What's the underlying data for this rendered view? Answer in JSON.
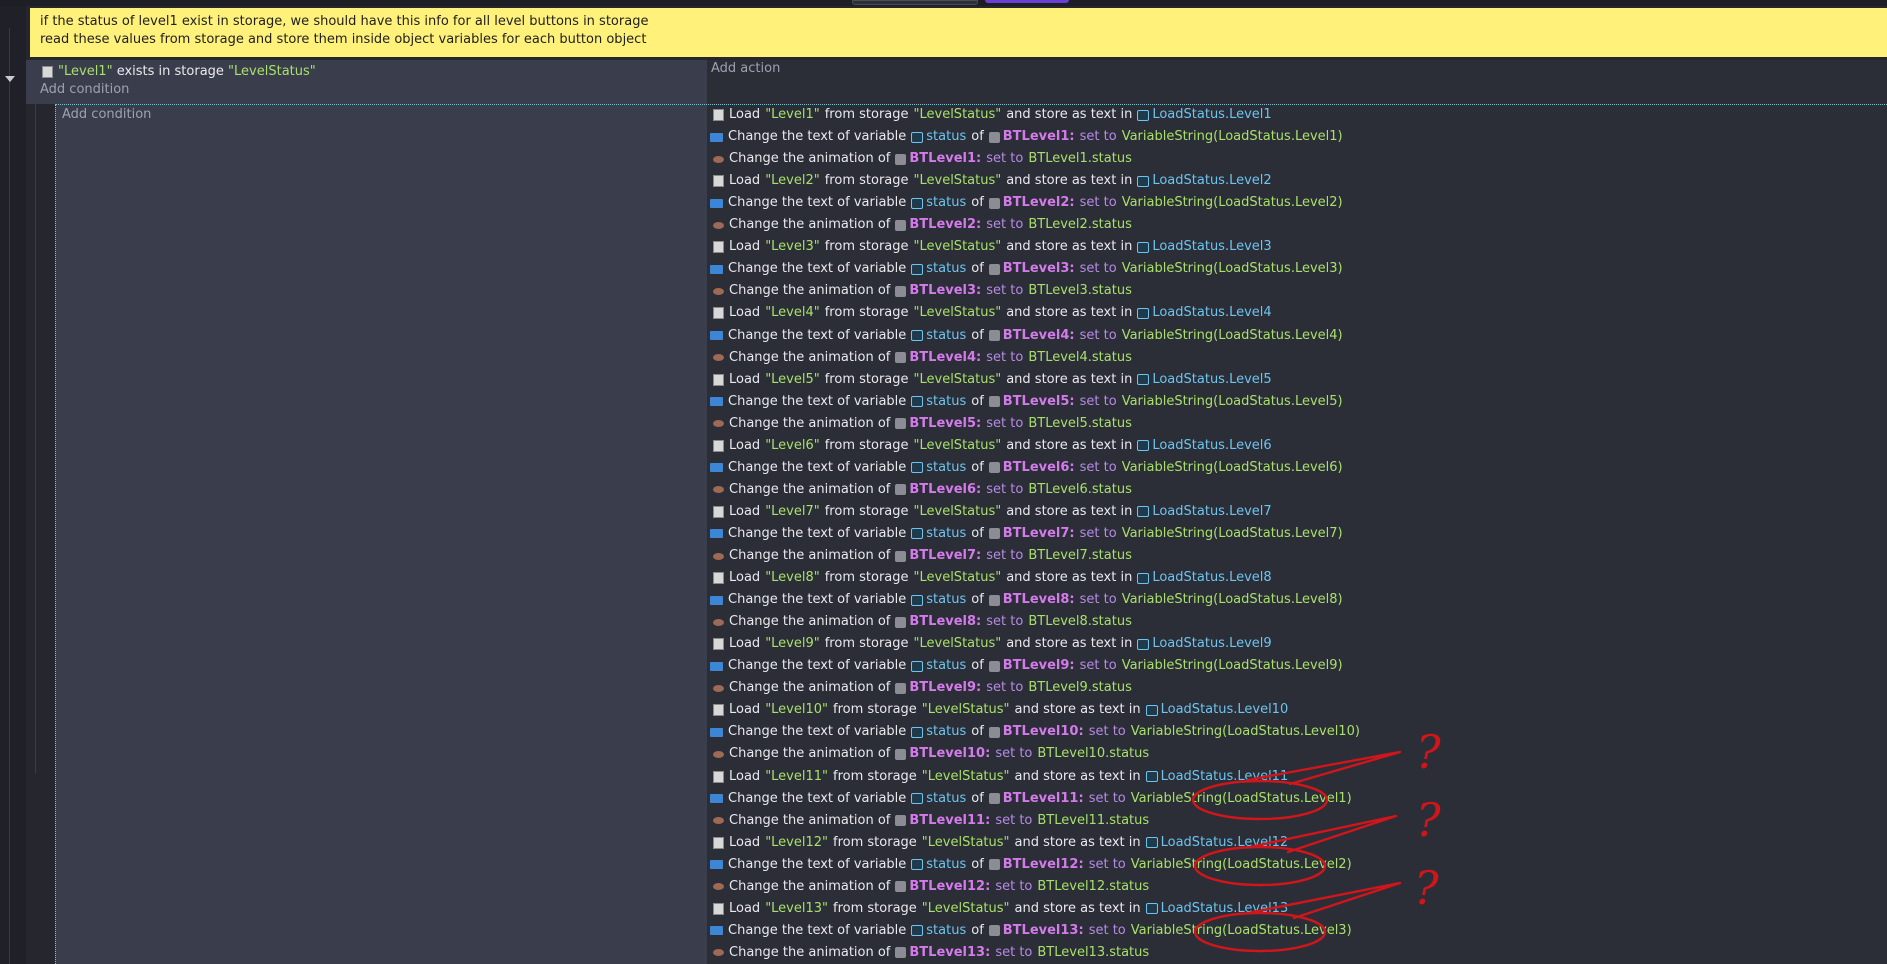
{
  "comment": {
    "line1": "if the status of level1 exist in storage, we should have this info for all level buttons in storage",
    "line2": "read these values from storage and store them inside object variables for each button object"
  },
  "event": {
    "condition": {
      "quote_open": "\"",
      "name": "Level1",
      "quote_close": "\"",
      "text": " exists in storage ",
      "storage": "\"LevelStatus\""
    },
    "add_condition": "Add condition",
    "add_action": "Add action"
  },
  "sub_event": {
    "add_condition": "Add condition"
  },
  "labels": {
    "load": "Load",
    "from_storage": "from storage",
    "and_store": "and store as text in",
    "change_text": "Change the text of variable",
    "status": "status",
    "of": "of",
    "set_to": "set to",
    "change_anim": "Change the animation of",
    "storage_name": "\"LevelStatus\""
  },
  "actions": [
    {
      "load_key": "\"Level1\"",
      "load_target": "LoadStatus.Level1",
      "obj": "BTLevel1:",
      "text_value": "VariableString(LoadStatus.Level1)",
      "anim_value": "BTLevel1.status"
    },
    {
      "load_key": "\"Level2\"",
      "load_target": "LoadStatus.Level2",
      "obj": "BTLevel2:",
      "text_value": "VariableString(LoadStatus.Level2)",
      "anim_value": "BTLevel2.status"
    },
    {
      "load_key": "\"Level3\"",
      "load_target": "LoadStatus.Level3",
      "obj": "BTLevel3:",
      "text_value": "VariableString(LoadStatus.Level3)",
      "anim_value": "BTLevel3.status"
    },
    {
      "load_key": "\"Level4\"",
      "load_target": "LoadStatus.Level4",
      "obj": "BTLevel4:",
      "text_value": "VariableString(LoadStatus.Level4)",
      "anim_value": "BTLevel4.status"
    },
    {
      "load_key": "\"Level5\"",
      "load_target": "LoadStatus.Level5",
      "obj": "BTLevel5:",
      "text_value": "VariableString(LoadStatus.Level5)",
      "anim_value": "BTLevel5.status"
    },
    {
      "load_key": "\"Level6\"",
      "load_target": "LoadStatus.Level6",
      "obj": "BTLevel6:",
      "text_value": "VariableString(LoadStatus.Level6)",
      "anim_value": "BTLevel6.status"
    },
    {
      "load_key": "\"Level7\"",
      "load_target": "LoadStatus.Level7",
      "obj": "BTLevel7:",
      "text_value": "VariableString(LoadStatus.Level7)",
      "anim_value": "BTLevel7.status"
    },
    {
      "load_key": "\"Level8\"",
      "load_target": "LoadStatus.Level8",
      "obj": "BTLevel8:",
      "text_value": "VariableString(LoadStatus.Level8)",
      "anim_value": "BTLevel8.status"
    },
    {
      "load_key": "\"Level9\"",
      "load_target": "LoadStatus.Level9",
      "obj": "BTLevel9:",
      "text_value": "VariableString(LoadStatus.Level9)",
      "anim_value": "BTLevel9.status"
    },
    {
      "load_key": "\"Level10\"",
      "load_target": "LoadStatus.Level10",
      "obj": "BTLevel10:",
      "text_value": "VariableString(LoadStatus.Level10)",
      "anim_value": "BTLevel10.status"
    },
    {
      "load_key": "\"Level11\"",
      "load_target": "LoadStatus.Level11",
      "obj": "BTLevel11:",
      "text_value": "VariableString(LoadStatus.Level1)",
      "anim_value": "BTLevel11.status"
    },
    {
      "load_key": "\"Level12\"",
      "load_target": "LoadStatus.Level12",
      "obj": "BTLevel12:",
      "text_value": "VariableString(LoadStatus.Level2)",
      "anim_value": "BTLevel12.status"
    },
    {
      "load_key": "\"Level13\"",
      "load_target": "LoadStatus.Level13",
      "obj": "BTLevel13:",
      "text_value": "VariableString(LoadStatus.Level3)",
      "anim_value": "BTLevel13.status"
    }
  ],
  "annotations": {
    "mark": "?",
    "color": "#d0161b"
  },
  "colors": {
    "comment_bg": "#fff17a",
    "condition_bg": "#3a3d4c",
    "action_bg": "#2b2d37",
    "string": "#a7e06a",
    "variable": "#6cc5ef",
    "object": "#d37bea",
    "keyword": "#b78ae6"
  },
  "icons": {
    "storage": "storage-icon",
    "text_variable": "text-variable-icon",
    "animation": "animation-icon",
    "variable": "variable-icon",
    "object": "object-thumbnail-icon"
  }
}
